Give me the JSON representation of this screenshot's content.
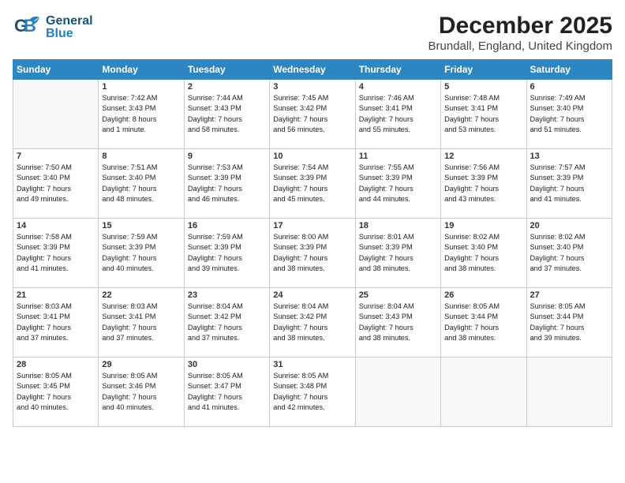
{
  "header": {
    "logo_general": "General",
    "logo_blue": "Blue",
    "title": "December 2025",
    "subtitle": "Brundall, England, United Kingdom"
  },
  "weekdays": [
    "Sunday",
    "Monday",
    "Tuesday",
    "Wednesday",
    "Thursday",
    "Friday",
    "Saturday"
  ],
  "weeks": [
    [
      {
        "day": "",
        "info": ""
      },
      {
        "day": "1",
        "info": "Sunrise: 7:42 AM\nSunset: 3:43 PM\nDaylight: 8 hours\nand 1 minute."
      },
      {
        "day": "2",
        "info": "Sunrise: 7:44 AM\nSunset: 3:43 PM\nDaylight: 7 hours\nand 58 minutes."
      },
      {
        "day": "3",
        "info": "Sunrise: 7:45 AM\nSunset: 3:42 PM\nDaylight: 7 hours\nand 56 minutes."
      },
      {
        "day": "4",
        "info": "Sunrise: 7:46 AM\nSunset: 3:41 PM\nDaylight: 7 hours\nand 55 minutes."
      },
      {
        "day": "5",
        "info": "Sunrise: 7:48 AM\nSunset: 3:41 PM\nDaylight: 7 hours\nand 53 minutes."
      },
      {
        "day": "6",
        "info": "Sunrise: 7:49 AM\nSunset: 3:40 PM\nDaylight: 7 hours\nand 51 minutes."
      }
    ],
    [
      {
        "day": "7",
        "info": "Sunrise: 7:50 AM\nSunset: 3:40 PM\nDaylight: 7 hours\nand 49 minutes."
      },
      {
        "day": "8",
        "info": "Sunrise: 7:51 AM\nSunset: 3:40 PM\nDaylight: 7 hours\nand 48 minutes."
      },
      {
        "day": "9",
        "info": "Sunrise: 7:53 AM\nSunset: 3:39 PM\nDaylight: 7 hours\nand 46 minutes."
      },
      {
        "day": "10",
        "info": "Sunrise: 7:54 AM\nSunset: 3:39 PM\nDaylight: 7 hours\nand 45 minutes."
      },
      {
        "day": "11",
        "info": "Sunrise: 7:55 AM\nSunset: 3:39 PM\nDaylight: 7 hours\nand 44 minutes."
      },
      {
        "day": "12",
        "info": "Sunrise: 7:56 AM\nSunset: 3:39 PM\nDaylight: 7 hours\nand 43 minutes."
      },
      {
        "day": "13",
        "info": "Sunrise: 7:57 AM\nSunset: 3:39 PM\nDaylight: 7 hours\nand 41 minutes."
      }
    ],
    [
      {
        "day": "14",
        "info": "Sunrise: 7:58 AM\nSunset: 3:39 PM\nDaylight: 7 hours\nand 41 minutes."
      },
      {
        "day": "15",
        "info": "Sunrise: 7:59 AM\nSunset: 3:39 PM\nDaylight: 7 hours\nand 40 minutes."
      },
      {
        "day": "16",
        "info": "Sunrise: 7:59 AM\nSunset: 3:39 PM\nDaylight: 7 hours\nand 39 minutes."
      },
      {
        "day": "17",
        "info": "Sunrise: 8:00 AM\nSunset: 3:39 PM\nDaylight: 7 hours\nand 38 minutes."
      },
      {
        "day": "18",
        "info": "Sunrise: 8:01 AM\nSunset: 3:39 PM\nDaylight: 7 hours\nand 38 minutes."
      },
      {
        "day": "19",
        "info": "Sunrise: 8:02 AM\nSunset: 3:40 PM\nDaylight: 7 hours\nand 38 minutes."
      },
      {
        "day": "20",
        "info": "Sunrise: 8:02 AM\nSunset: 3:40 PM\nDaylight: 7 hours\nand 37 minutes."
      }
    ],
    [
      {
        "day": "21",
        "info": "Sunrise: 8:03 AM\nSunset: 3:41 PM\nDaylight: 7 hours\nand 37 minutes."
      },
      {
        "day": "22",
        "info": "Sunrise: 8:03 AM\nSunset: 3:41 PM\nDaylight: 7 hours\nand 37 minutes."
      },
      {
        "day": "23",
        "info": "Sunrise: 8:04 AM\nSunset: 3:42 PM\nDaylight: 7 hours\nand 37 minutes."
      },
      {
        "day": "24",
        "info": "Sunrise: 8:04 AM\nSunset: 3:42 PM\nDaylight: 7 hours\nand 38 minutes."
      },
      {
        "day": "25",
        "info": "Sunrise: 8:04 AM\nSunset: 3:43 PM\nDaylight: 7 hours\nand 38 minutes."
      },
      {
        "day": "26",
        "info": "Sunrise: 8:05 AM\nSunset: 3:44 PM\nDaylight: 7 hours\nand 38 minutes."
      },
      {
        "day": "27",
        "info": "Sunrise: 8:05 AM\nSunset: 3:44 PM\nDaylight: 7 hours\nand 39 minutes."
      }
    ],
    [
      {
        "day": "28",
        "info": "Sunrise: 8:05 AM\nSunset: 3:45 PM\nDaylight: 7 hours\nand 40 minutes."
      },
      {
        "day": "29",
        "info": "Sunrise: 8:05 AM\nSunset: 3:46 PM\nDaylight: 7 hours\nand 40 minutes."
      },
      {
        "day": "30",
        "info": "Sunrise: 8:05 AM\nSunset: 3:47 PM\nDaylight: 7 hours\nand 41 minutes."
      },
      {
        "day": "31",
        "info": "Sunrise: 8:05 AM\nSunset: 3:48 PM\nDaylight: 7 hours\nand 42 minutes."
      },
      {
        "day": "",
        "info": ""
      },
      {
        "day": "",
        "info": ""
      },
      {
        "day": "",
        "info": ""
      }
    ]
  ]
}
